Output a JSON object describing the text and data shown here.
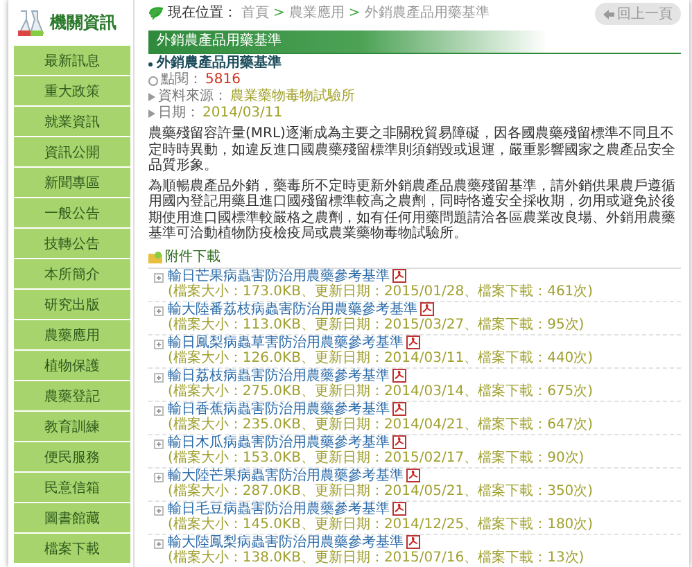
{
  "sidebar": {
    "title": "機關資訊",
    "items": [
      "最新訊息",
      "重大政策",
      "就業資訊",
      "資訊公開",
      "新聞專區",
      "一般公告",
      "技轉公告",
      "本所簡介",
      "研究出版",
      "農藥應用",
      "植物保護",
      "農藥登記",
      "教育訓練",
      "便民服務",
      "民意信箱",
      "圖書館藏",
      "檔案下載"
    ]
  },
  "breadcrumb": {
    "label": "現在位置：",
    "separator": ">",
    "items": [
      "首頁",
      "農業應用",
      "外銷農產品用藥基準"
    ]
  },
  "back_button": "回上一頁",
  "article": {
    "banner": "外銷農產品用藥基準",
    "title": "外銷農產品用藥基準",
    "views_label": "點閱：",
    "views": "5816",
    "source_label": "資料來源：",
    "source": "農業藥物毒物試驗所",
    "date_label": "日期：",
    "date": "2014/03/11",
    "paragraphs": [
      "農藥殘留容許量(MRL)逐漸成為主要之非關稅貿易障礙，因各國農藥殘留標準不同且不定時時異動，如違反進口國農藥殘留標準則須銷毀或退運，嚴重影響國家之農產品安全品質形象。",
      "為順暢農產品外銷，藥毒所不定時更新外銷農產品農藥殘留基準，請外銷供果農戶遵循用國內登記用藥且進口國殘留標準較高之農劑，同時恪遵安全採收期，勿用或避免於後期使用進口國標準較嚴格之農劑，如有任何用藥問題請洽各區農業改良場、外銷用農藥基準可洽動植物防疫檢疫局或農業藥物毒物試驗所。"
    ]
  },
  "attachments": {
    "title": "附件下載",
    "items": [
      {
        "name": "輸日芒果病蟲害防治用農藥參考基準",
        "meta": "(檔案大小：173.0KB、更新日期：2015/01/28、檔案下載：461次)"
      },
      {
        "name": "輸大陸番荔枝病蟲害防治用農藥參考基準",
        "meta": "(檔案大小：113.0KB、更新日期：2015/03/27、檔案下載：95次)"
      },
      {
        "name": "輸日鳳梨病蟲草害防治用農藥參考基準",
        "meta": "(檔案大小：126.0KB、更新日期：2014/03/11、檔案下載：440次)"
      },
      {
        "name": "輸日荔枝病蟲害防治用農藥參考基準",
        "meta": "(檔案大小：275.0KB、更新日期：2014/03/14、檔案下載：675次)"
      },
      {
        "name": "輸日香蕉病蟲害防治用農藥參考基準",
        "meta": "(檔案大小：235.0KB、更新日期：2014/04/21、檔案下載：647次)"
      },
      {
        "name": "輸日木瓜病蟲害防治用農藥參考基準",
        "meta": "(檔案大小：153.0KB、更新日期：2015/02/17、檔案下載：90次)"
      },
      {
        "name": "輸大陸芒果病蟲害防治用農藥參考基準",
        "meta": "(檔案大小：287.0KB、更新日期：2014/05/21、檔案下載：350次)"
      },
      {
        "name": "輸日毛豆病蟲害防治用農藥參考基準",
        "meta": "(檔案大小：145.0KB、更新日期：2014/12/25、檔案下載：180次)"
      },
      {
        "name": "輸大陸鳳梨病蟲害防治用農藥參考基準",
        "meta": "(檔案大小：138.0KB、更新日期：2015/07/16、檔案下載：13次)"
      }
    ]
  }
}
